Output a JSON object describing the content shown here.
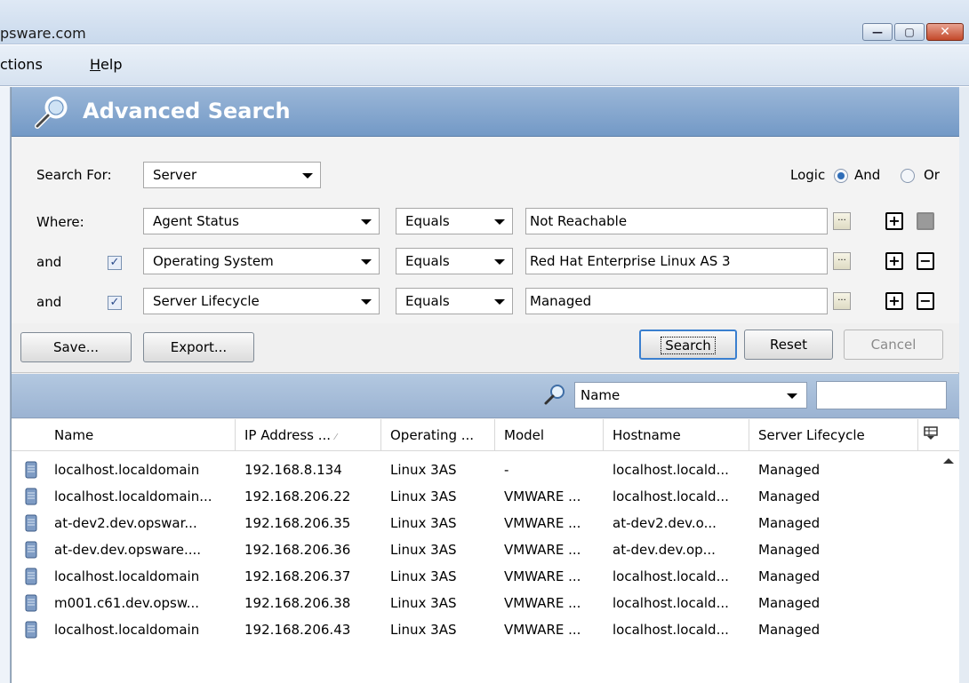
{
  "window": {
    "title": "psware.com",
    "min_glyph": "—",
    "max_glyph": "▢",
    "close_glyph": "✕"
  },
  "menu": {
    "actions_prefix": "",
    "actions_rest": "ctions",
    "help_underlined": "H",
    "help_rest": "elp"
  },
  "panel": {
    "title": "Advanced Search"
  },
  "criteria": {
    "search_for_label": "Search For:",
    "search_for_value": "Server",
    "logic_label": "Logic",
    "logic_and": "And",
    "logic_or": "Or",
    "logic_selected": "And",
    "rows": [
      {
        "prefix": "Where:",
        "checkbox": false,
        "attribute": "Agent Status",
        "operator": "Equals",
        "value": "Not Reachable",
        "remove_enabled": false
      },
      {
        "prefix": "and",
        "checkbox": true,
        "attribute": "Operating System",
        "operator": "Equals",
        "value": "Red Hat Enterprise Linux AS 3",
        "remove_enabled": true
      },
      {
        "prefix": "and",
        "checkbox": true,
        "attribute": "Server Lifecycle",
        "operator": "Equals",
        "value": "Managed",
        "remove_enabled": true
      }
    ],
    "ellipsis_glyph": "...",
    "plus_glyph": "+",
    "minus_glyph": "−",
    "check_glyph": "✓"
  },
  "buttons": {
    "save": "Save...",
    "export": "Export...",
    "search": "Search",
    "reset": "Reset",
    "cancel": "Cancel"
  },
  "filter": {
    "field": "Name",
    "query": ""
  },
  "table": {
    "columns": [
      "Name",
      "IP Address ...",
      "Operating ...",
      "Model",
      "Hostname",
      "Server Lifecycle"
    ],
    "sort_glyph": "⁄",
    "rows": [
      [
        "localhost.localdomain",
        "192.168.8.134",
        "Linux 3AS",
        "-",
        "localhost.locald...",
        "Managed"
      ],
      [
        "localhost.localdomain...",
        "192.168.206.22",
        "Linux 3AS",
        "VMWARE ...",
        "localhost.locald...",
        "Managed"
      ],
      [
        "at-dev2.dev.opswar...",
        "192.168.206.35",
        "Linux 3AS",
        "VMWARE ...",
        "at-dev2.dev.o...",
        "Managed"
      ],
      [
        "at-dev.dev.opsware....",
        "192.168.206.36",
        "Linux 3AS",
        "VMWARE ...",
        "at-dev.dev.op...",
        "Managed"
      ],
      [
        "localhost.localdomain",
        "192.168.206.37",
        "Linux 3AS",
        "VMWARE ...",
        "localhost.locald...",
        "Managed"
      ],
      [
        "m001.c61.dev.opsw...",
        "192.168.206.38",
        "Linux 3AS",
        "VMWARE ...",
        "localhost.locald...",
        "Managed"
      ],
      [
        "localhost.localdomain",
        "192.168.206.43",
        "Linux 3AS",
        "VMWARE ...",
        "localhost.locald...",
        "Managed"
      ]
    ]
  }
}
